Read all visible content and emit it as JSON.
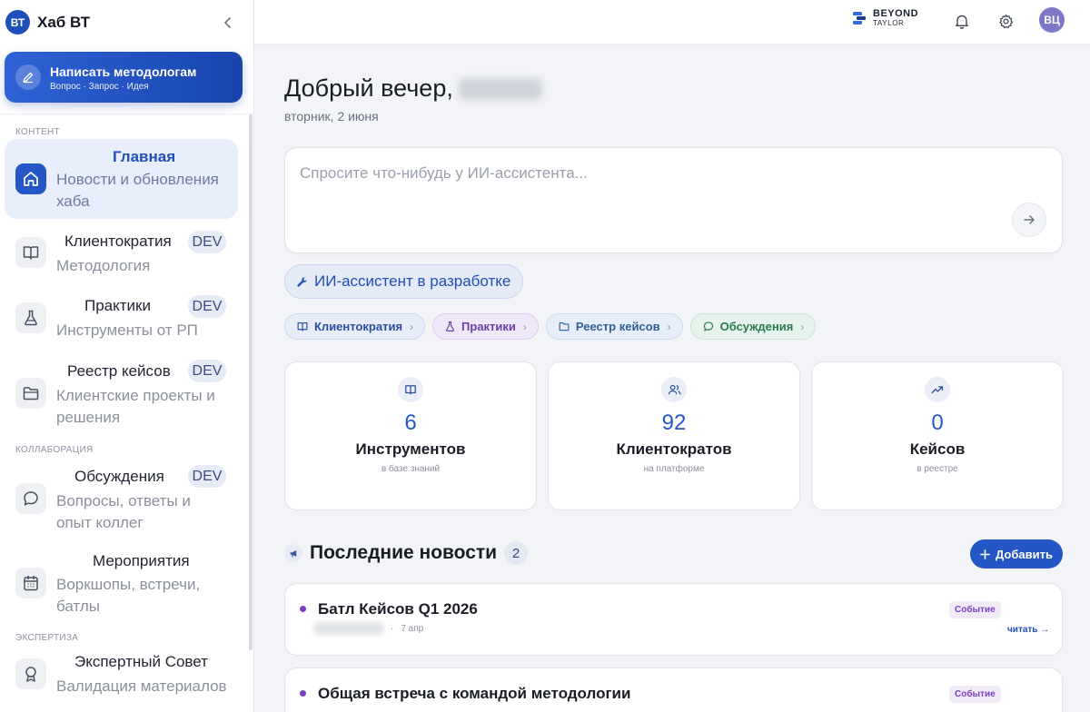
{
  "sidebar": {
    "brand_logo": "ВТ",
    "brand_title": "Хаб ВТ",
    "write_button": {
      "title": "Написать методологам",
      "subtitle": "Вопрос · Запрос · Идея"
    },
    "sections": {
      "content": "КОНТЕНТ",
      "collab": "КОЛЛАБОРАЦИЯ",
      "expertise": "ЭКСПЕРТИЗА"
    },
    "items": [
      {
        "title": "Главная",
        "desc": "Новости и обновления хаба",
        "icon": "home-icon",
        "active": true,
        "badge": ""
      },
      {
        "title": "Клиентократия",
        "desc": "Методология",
        "icon": "book-icon",
        "badge": "DEV"
      },
      {
        "title": "Практики",
        "desc": "Инструменты от РП",
        "icon": "flask-icon",
        "badge": "DEV"
      },
      {
        "title": "Реестр кейсов",
        "desc": "Клиентские проекты и решения",
        "icon": "folder-icon",
        "badge": "DEV"
      },
      {
        "title": "Обсуждения",
        "desc": "Вопросы, ответы и опыт коллег",
        "icon": "chat-icon",
        "badge": "DEV"
      },
      {
        "title": "Мероприятия",
        "desc": "Воркшопы, встречи, батлы",
        "icon": "calendar-icon",
        "badge": ""
      },
      {
        "title": "Экспертный Совет",
        "desc": "Валидация материалов",
        "icon": "award-icon",
        "badge": ""
      }
    ]
  },
  "topbar": {
    "logo_line1": "BEYOND",
    "logo_line2": "TAYLOR",
    "avatar": "ВЦ"
  },
  "main": {
    "greeting": "Добрый вечер,",
    "date": "вторник, 2 июня",
    "ai_placeholder": "Спросите что-нибудь у ИИ-ассистента...",
    "dev_pill": "ИИ-ассистент в разработке",
    "chips": [
      "Клиентократия",
      "Практики",
      "Реестр кейсов",
      "Обсуждения"
    ],
    "stats": [
      {
        "value": "6",
        "label": "Инструментов",
        "sub": "в базе знаний",
        "icon": "book-icon"
      },
      {
        "value": "92",
        "label": "Клиентократов",
        "sub": "на платформе",
        "icon": "users-icon"
      },
      {
        "value": "0",
        "label": "Кейсов",
        "sub": "в реестре",
        "icon": "trend-icon"
      }
    ],
    "news": {
      "title": "Последние новости",
      "count": "2",
      "add_label": "Добавить",
      "items": [
        {
          "title": "Батл Кейсов Q1 2026",
          "tag": "Событие",
          "date": "7 апр",
          "read": "читать →"
        },
        {
          "title": "Общая встреча с командой методологии",
          "tag": "Событие"
        }
      ]
    }
  },
  "colors": {
    "accent": "#2457c5",
    "event_purple": "#7b3fc2",
    "background": "#f3f4f7"
  }
}
